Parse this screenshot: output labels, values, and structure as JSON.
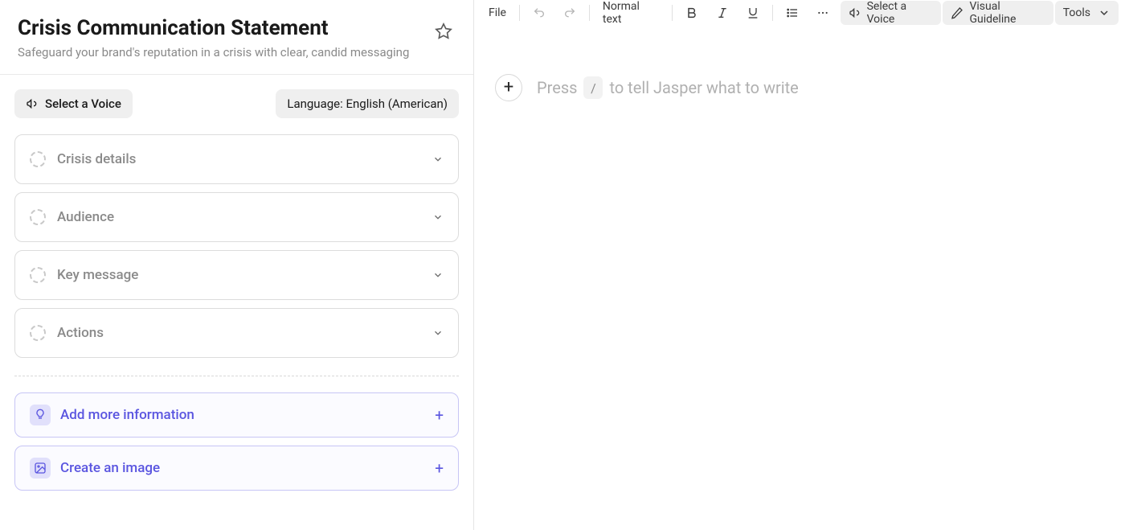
{
  "page": {
    "title": "Crisis Communication Statement",
    "subtitle": "Safeguard your brand's reputation in a crisis with clear, candid messaging"
  },
  "leftTop": {
    "voiceBtn": "Select a Voice",
    "language": "Language: English (American)"
  },
  "accordions": [
    {
      "label": "Crisis details"
    },
    {
      "label": "Audience"
    },
    {
      "label": "Key message"
    },
    {
      "label": "Actions"
    }
  ],
  "purpleCards": {
    "addInfo": "Add more information",
    "createImage": "Create an image"
  },
  "toolbar": {
    "file": "File",
    "normalText": "Normal text",
    "voice": "Select a Voice",
    "visualGuideline": "Visual Guideline",
    "tools": "Tools"
  },
  "editor": {
    "placeholderBefore": "Press",
    "slash": "/",
    "placeholderAfter": "to tell Jasper what to write"
  }
}
